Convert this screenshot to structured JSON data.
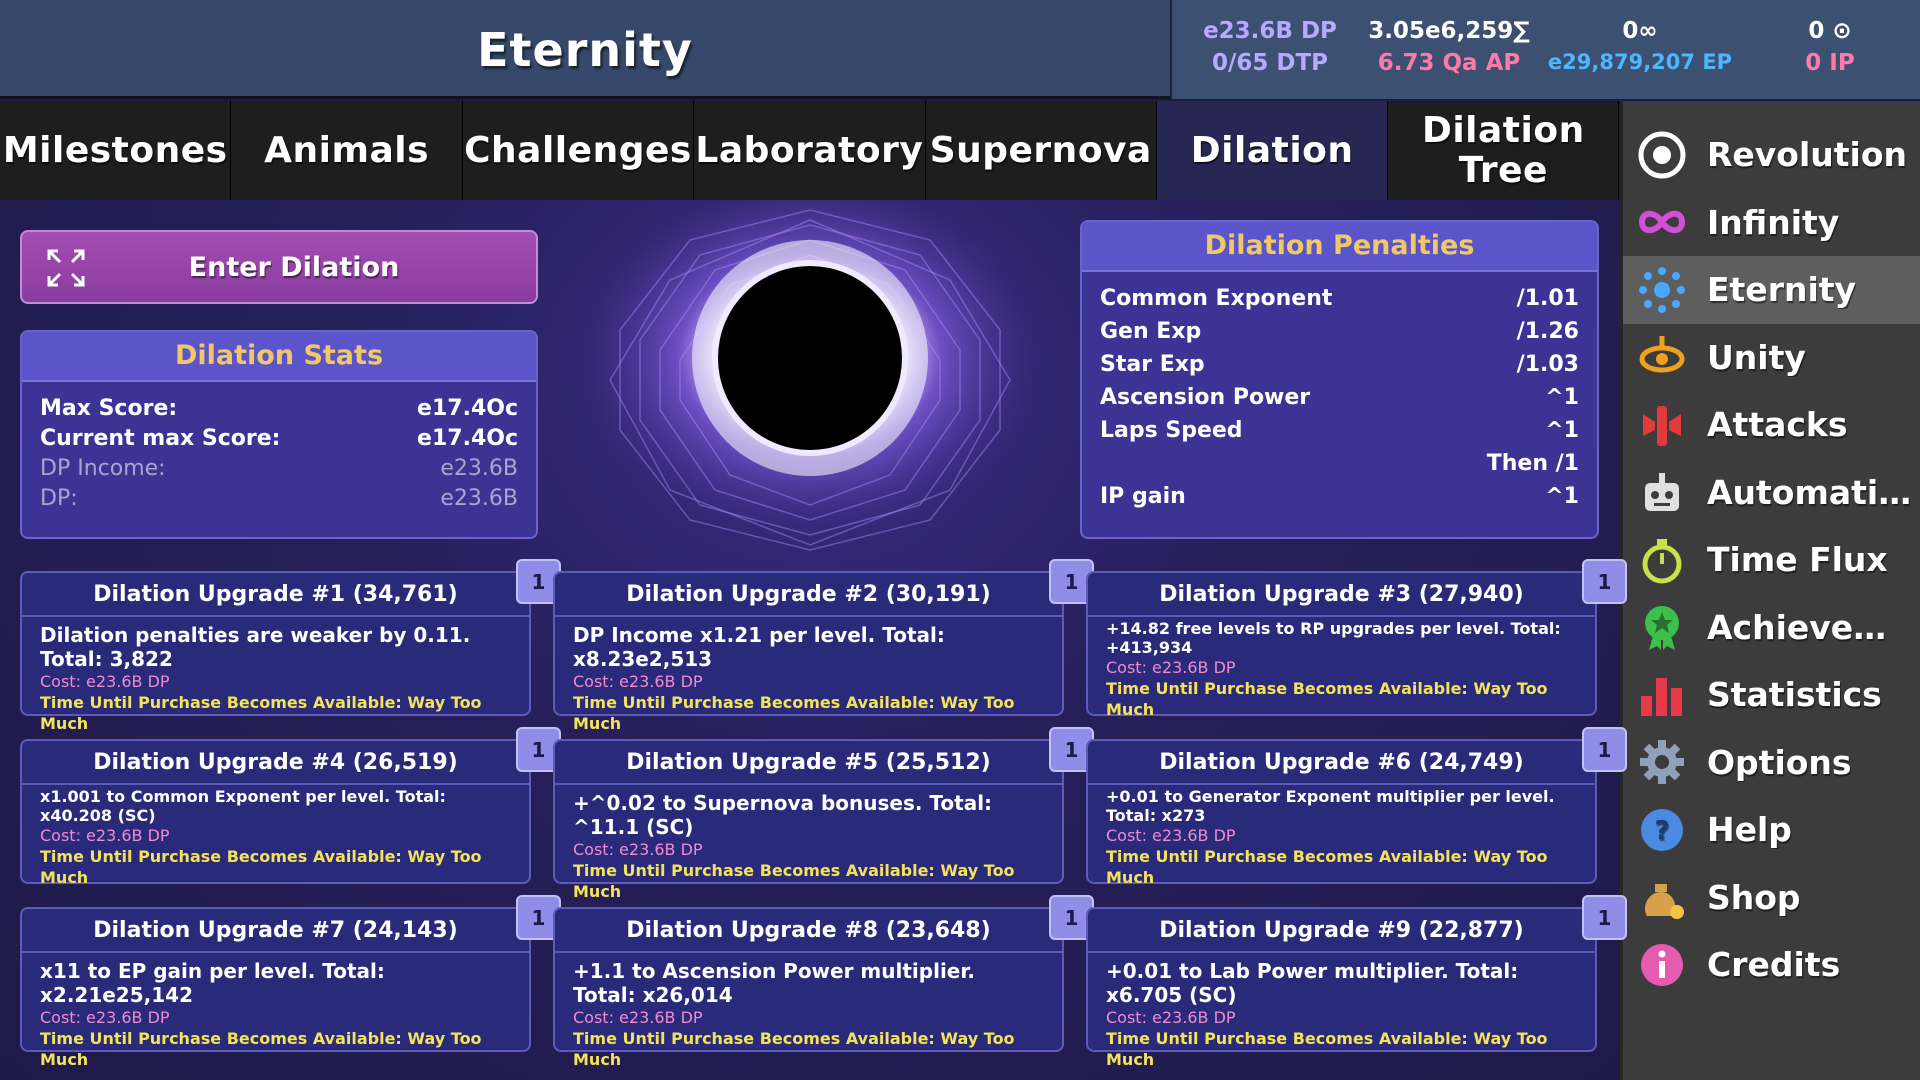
{
  "header": {
    "title": "Eternity",
    "resources": {
      "dp": "e23.6B DP",
      "dtp": "0/65 DTP",
      "sigma": "3.05e6,259∑",
      "ap": "6.73 Qa AP",
      "infinity_count": "0∞",
      "ep": "e29,879,207 EP",
      "revolution_count": "0 ⊙",
      "ip": "0 IP"
    }
  },
  "tabs": [
    "Milestones",
    "Animals",
    "Challenges",
    "Laboratory",
    "Supernova",
    "Dilation",
    "Dilation Tree"
  ],
  "active_tab": "Dilation",
  "sidebar": {
    "items": [
      {
        "label": "Revolution",
        "icon": "revolution-icon"
      },
      {
        "label": "Infinity",
        "icon": "infinity-icon"
      },
      {
        "label": "Eternity",
        "icon": "eternity-icon",
        "active": true
      },
      {
        "label": "Unity",
        "icon": "unity-icon"
      },
      {
        "label": "Attacks",
        "icon": "attacks-icon"
      },
      {
        "label": "Automation",
        "icon": "robot-icon"
      },
      {
        "label": "Time Flux",
        "icon": "stopwatch-icon"
      },
      {
        "label": "Achieveme...",
        "icon": "achievement-icon"
      },
      {
        "label": "Statistics",
        "icon": "bar-chart-icon"
      },
      {
        "label": "Options",
        "icon": "gear-icon"
      },
      {
        "label": "Help",
        "icon": "help-icon"
      },
      {
        "label": "Shop",
        "icon": "coin-bag-icon"
      },
      {
        "label": "Credits",
        "icon": "info-icon"
      }
    ]
  },
  "enter_dilation": {
    "label": "Enter Dilation"
  },
  "stats": {
    "title": "Dilation Stats",
    "rows": [
      {
        "label": "Max Score:",
        "value": "e17.4Oc"
      },
      {
        "label": "Current max Score:",
        "value": "e17.4Oc"
      },
      {
        "label": "DP Income:",
        "value": "e23.6B"
      },
      {
        "label": "DP:",
        "value": "e23.6B"
      }
    ]
  },
  "penalties": {
    "title": "Dilation Penalties",
    "rows": [
      {
        "label": "Common Exponent",
        "value": "/1.01"
      },
      {
        "label": "Gen Exp",
        "value": "/1.26"
      },
      {
        "label": "Star Exp",
        "value": "/1.03"
      },
      {
        "label": "Ascension Power",
        "value": "^1"
      },
      {
        "label": "Laps Speed",
        "value": "^1"
      },
      {
        "label": "",
        "value": "Then /1"
      },
      {
        "label": "IP gain",
        "value": "^1"
      }
    ]
  },
  "upgrades": [
    {
      "title": "Dilation Upgrade #1 (34,761)",
      "desc": "Dilation penalties are weaker by 0.11. Total: 3,822",
      "cost": "Cost: e23.6B DP",
      "time": "Time Until Purchase Becomes Available: Way Too Much",
      "badge": "1"
    },
    {
      "title": "Dilation Upgrade #2 (30,191)",
      "desc": "DP Income x1.21 per level. Total: x8.23e2,513",
      "cost": "Cost: e23.6B DP",
      "time": "Time Until Purchase Becomes Available: Way Too Much",
      "badge": "1"
    },
    {
      "title": "Dilation Upgrade #3 (27,940)",
      "desc": "+14.82 free levels to RP upgrades per level. Total: +413,934",
      "cost": "Cost: e23.6B DP",
      "time": "Time Until Purchase Becomes Available: Way Too Much",
      "badge": "1"
    },
    {
      "title": "Dilation Upgrade #4 (26,519)",
      "desc": "x1.001 to Common Exponent per level. Total: x40.208 (SC)",
      "cost": "Cost: e23.6B DP",
      "time": "Time Until Purchase Becomes Available: Way Too Much",
      "badge": "1"
    },
    {
      "title": "Dilation Upgrade #5 (25,512)",
      "desc": "+^0.02 to Supernova bonuses. Total: ^11.1 (SC)",
      "cost": "Cost: e23.6B DP",
      "time": "Time Until Purchase Becomes Available: Way Too Much",
      "badge": "1"
    },
    {
      "title": "Dilation Upgrade #6 (24,749)",
      "desc": "+0.01 to Generator Exponent multiplier per level. Total: x273",
      "cost": "Cost: e23.6B DP",
      "time": "Time Until Purchase Becomes Available: Way Too Much",
      "badge": "1"
    },
    {
      "title": "Dilation Upgrade #7 (24,143)",
      "desc": "x11 to EP gain per level. Total: x2.21e25,142",
      "cost": "Cost: e23.6B DP",
      "time": "Time Until Purchase Becomes Available: Way Too Much",
      "badge": "1"
    },
    {
      "title": "Dilation Upgrade #8 (23,648)",
      "desc": "+1.1 to Ascension Power multiplier. Total: x26,014",
      "cost": "Cost: e23.6B DP",
      "time": "Time Until Purchase Becomes Available: Way Too Much",
      "badge": "1"
    },
    {
      "title": "Dilation Upgrade #9 (22,877)",
      "desc": "+0.01 to Lab Power multiplier. Total: x6.705 (SC)",
      "cost": "Cost: e23.6B DP",
      "time": "Time Until Purchase Becomes Available: Way Too Much",
      "badge": "1"
    }
  ],
  "colors": {
    "header_bg": "#36496b",
    "panel_head": "#5c55c9",
    "panel_title_text": "#f1c866",
    "cost_text": "#f08bd0",
    "time_text": "#f3e25a",
    "enter_button": "#a44cb3"
  }
}
